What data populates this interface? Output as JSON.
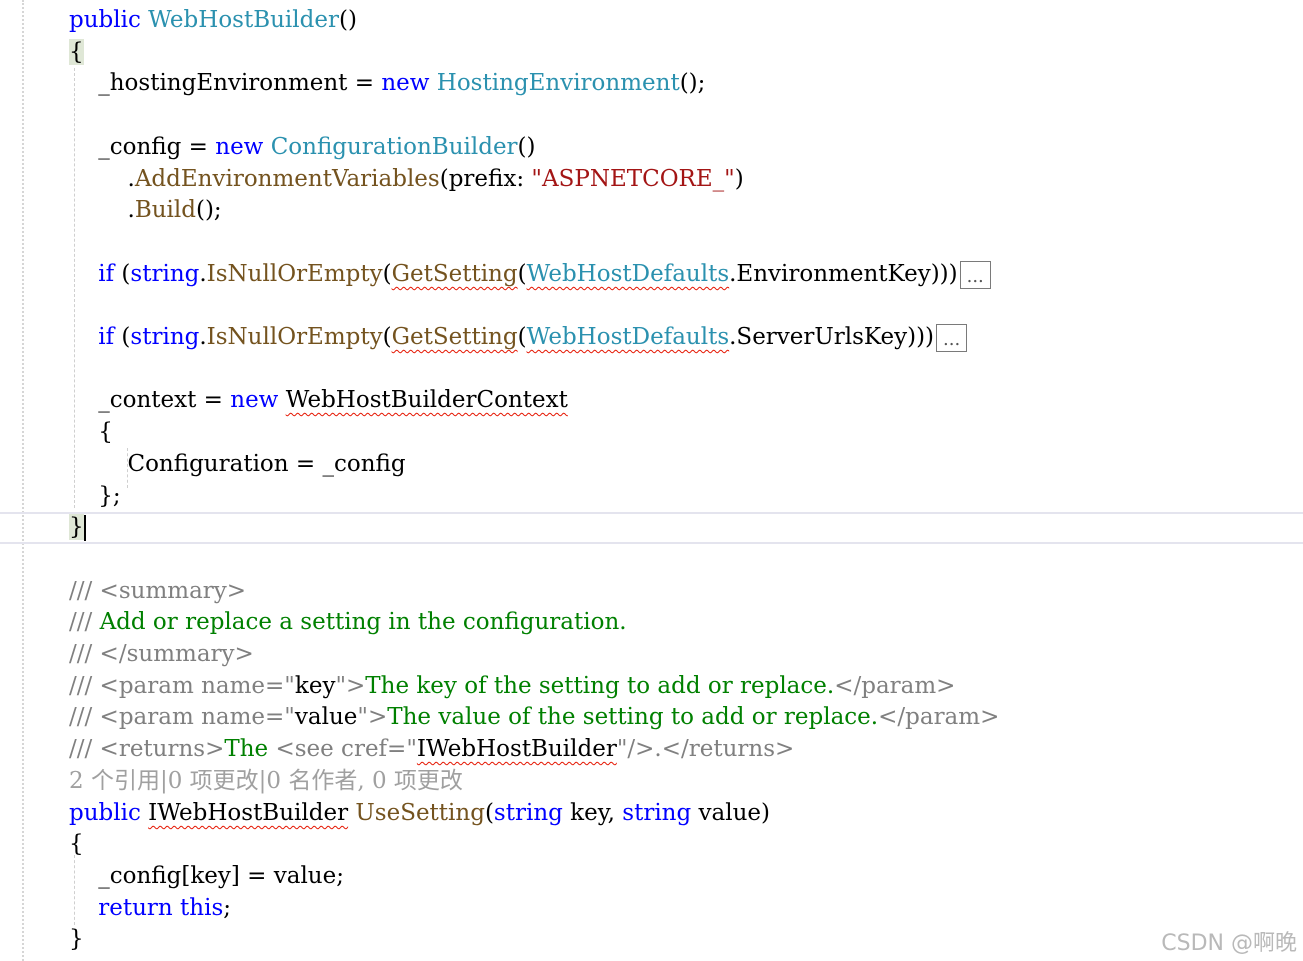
{
  "editor": {
    "lines": [
      {
        "tokens": [
          {
            "t": "public",
            "c": "kw"
          },
          {
            "t": " ",
            "c": "plain"
          },
          {
            "t": "WebHostBuilder",
            "c": "type"
          },
          {
            "t": "()",
            "c": "plain"
          }
        ]
      },
      {
        "tokens": [
          {
            "t": "{",
            "c": "plain brace-hl"
          }
        ]
      },
      {
        "tokens": [
          {
            "t": "    _hostingEnvironment = ",
            "c": "plain"
          },
          {
            "t": "new",
            "c": "kw"
          },
          {
            "t": " ",
            "c": "plain"
          },
          {
            "t": "HostingEnvironment",
            "c": "type"
          },
          {
            "t": "();",
            "c": "plain"
          }
        ]
      },
      {
        "tokens": []
      },
      {
        "tokens": [
          {
            "t": "    _config = ",
            "c": "plain"
          },
          {
            "t": "new",
            "c": "kw"
          },
          {
            "t": " ",
            "c": "plain"
          },
          {
            "t": "ConfigurationBuilder",
            "c": "type"
          },
          {
            "t": "()",
            "c": "plain"
          }
        ]
      },
      {
        "tokens": [
          {
            "t": "        .",
            "c": "plain"
          },
          {
            "t": "AddEnvironmentVariables",
            "c": "method"
          },
          {
            "t": "(prefix: ",
            "c": "plain"
          },
          {
            "t": "\"ASPNETCORE_\"",
            "c": "str"
          },
          {
            "t": ")",
            "c": "plain"
          }
        ]
      },
      {
        "tokens": [
          {
            "t": "        .",
            "c": "plain"
          },
          {
            "t": "Build",
            "c": "method"
          },
          {
            "t": "();",
            "c": "plain"
          }
        ]
      },
      {
        "tokens": []
      },
      {
        "tokens": [
          {
            "t": "    ",
            "c": "plain"
          },
          {
            "t": "if",
            "c": "kw"
          },
          {
            "t": " (",
            "c": "plain"
          },
          {
            "t": "string",
            "c": "kw"
          },
          {
            "t": ".",
            "c": "plain"
          },
          {
            "t": "IsNullOrEmpty",
            "c": "method"
          },
          {
            "t": "(",
            "c": "plain"
          },
          {
            "t": "GetSetting",
            "c": "method squig"
          },
          {
            "t": "(",
            "c": "plain"
          },
          {
            "t": "WebHostDefaults",
            "c": "type squig"
          },
          {
            "t": ".EnvironmentKey)))",
            "c": "plain"
          },
          {
            "t": "...",
            "c": "collapsed"
          }
        ]
      },
      {
        "tokens": []
      },
      {
        "tokens": [
          {
            "t": "    ",
            "c": "plain"
          },
          {
            "t": "if",
            "c": "kw"
          },
          {
            "t": " (",
            "c": "plain"
          },
          {
            "t": "string",
            "c": "kw"
          },
          {
            "t": ".",
            "c": "plain"
          },
          {
            "t": "IsNullOrEmpty",
            "c": "method"
          },
          {
            "t": "(",
            "c": "plain"
          },
          {
            "t": "GetSetting",
            "c": "method squig"
          },
          {
            "t": "(",
            "c": "plain"
          },
          {
            "t": "WebHostDefaults",
            "c": "type squig"
          },
          {
            "t": ".ServerUrlsKey)))",
            "c": "plain"
          },
          {
            "t": "...",
            "c": "collapsed"
          }
        ]
      },
      {
        "tokens": []
      },
      {
        "tokens": [
          {
            "t": "    _context = ",
            "c": "plain"
          },
          {
            "t": "new",
            "c": "kw"
          },
          {
            "t": " ",
            "c": "plain"
          },
          {
            "t": "WebHostBuilderContext",
            "c": "plain squig"
          }
        ]
      },
      {
        "tokens": [
          {
            "t": "    {",
            "c": "plain"
          }
        ]
      },
      {
        "tokens": [
          {
            "t": "        Configuration = _config",
            "c": "plain"
          }
        ]
      },
      {
        "tokens": [
          {
            "t": "    };",
            "c": "plain"
          }
        ]
      },
      {
        "tokens": [
          {
            "t": "}",
            "c": "plain brace-hl"
          },
          {
            "t": "",
            "c": "caret"
          }
        ]
      },
      {
        "tokens": []
      },
      {
        "tokens": [
          {
            "t": "/// <summary>",
            "c": "xml"
          }
        ]
      },
      {
        "tokens": [
          {
            "t": "/// ",
            "c": "xml"
          },
          {
            "t": "Add or replace a setting in the configuration.",
            "c": "cmt"
          }
        ]
      },
      {
        "tokens": [
          {
            "t": "/// </summary>",
            "c": "xml"
          }
        ]
      },
      {
        "tokens": [
          {
            "t": "/// <param name=\"",
            "c": "xml"
          },
          {
            "t": "key",
            "c": "plain"
          },
          {
            "t": "\">",
            "c": "xml"
          },
          {
            "t": "The key of the setting to add or replace.",
            "c": "cmt"
          },
          {
            "t": "</param>",
            "c": "xml"
          }
        ]
      },
      {
        "tokens": [
          {
            "t": "/// <param name=\"",
            "c": "xml"
          },
          {
            "t": "value",
            "c": "plain"
          },
          {
            "t": "\">",
            "c": "xml"
          },
          {
            "t": "The value of the setting to add or replace.",
            "c": "cmt"
          },
          {
            "t": "</param>",
            "c": "xml"
          }
        ]
      },
      {
        "tokens": [
          {
            "t": "/// <returns>",
            "c": "xml"
          },
          {
            "t": "The ",
            "c": "cmt"
          },
          {
            "t": "<see cref=\"",
            "c": "xml"
          },
          {
            "t": "IWebHostBuilder",
            "c": "plain squig"
          },
          {
            "t": "\"/>.</returns>",
            "c": "xml"
          }
        ]
      },
      {
        "tokens": [
          {
            "t": "2 个引用|0 项更改|0 名作者, 0 项更改",
            "c": "lens"
          }
        ]
      },
      {
        "tokens": [
          {
            "t": "public",
            "c": "kw"
          },
          {
            "t": " ",
            "c": "plain"
          },
          {
            "t": "IWebHostBuilder",
            "c": "plain squig"
          },
          {
            "t": " ",
            "c": "plain"
          },
          {
            "t": "UseSetting",
            "c": "method"
          },
          {
            "t": "(",
            "c": "plain"
          },
          {
            "t": "string",
            "c": "kw"
          },
          {
            "t": " key, ",
            "c": "plain"
          },
          {
            "t": "string",
            "c": "kw"
          },
          {
            "t": " value)",
            "c": "plain"
          }
        ]
      },
      {
        "tokens": [
          {
            "t": "{",
            "c": "plain"
          }
        ]
      },
      {
        "tokens": [
          {
            "t": "    _config[key] = value;",
            "c": "plain"
          }
        ]
      },
      {
        "tokens": [
          {
            "t": "    ",
            "c": "plain"
          },
          {
            "t": "return",
            "c": "kw"
          },
          {
            "t": " ",
            "c": "plain"
          },
          {
            "t": "this",
            "c": "kw"
          },
          {
            "t": ";",
            "c": "plain"
          }
        ]
      },
      {
        "tokens": [
          {
            "t": "}",
            "c": "plain"
          }
        ]
      }
    ]
  },
  "watermark": "CSDN @啊晚"
}
